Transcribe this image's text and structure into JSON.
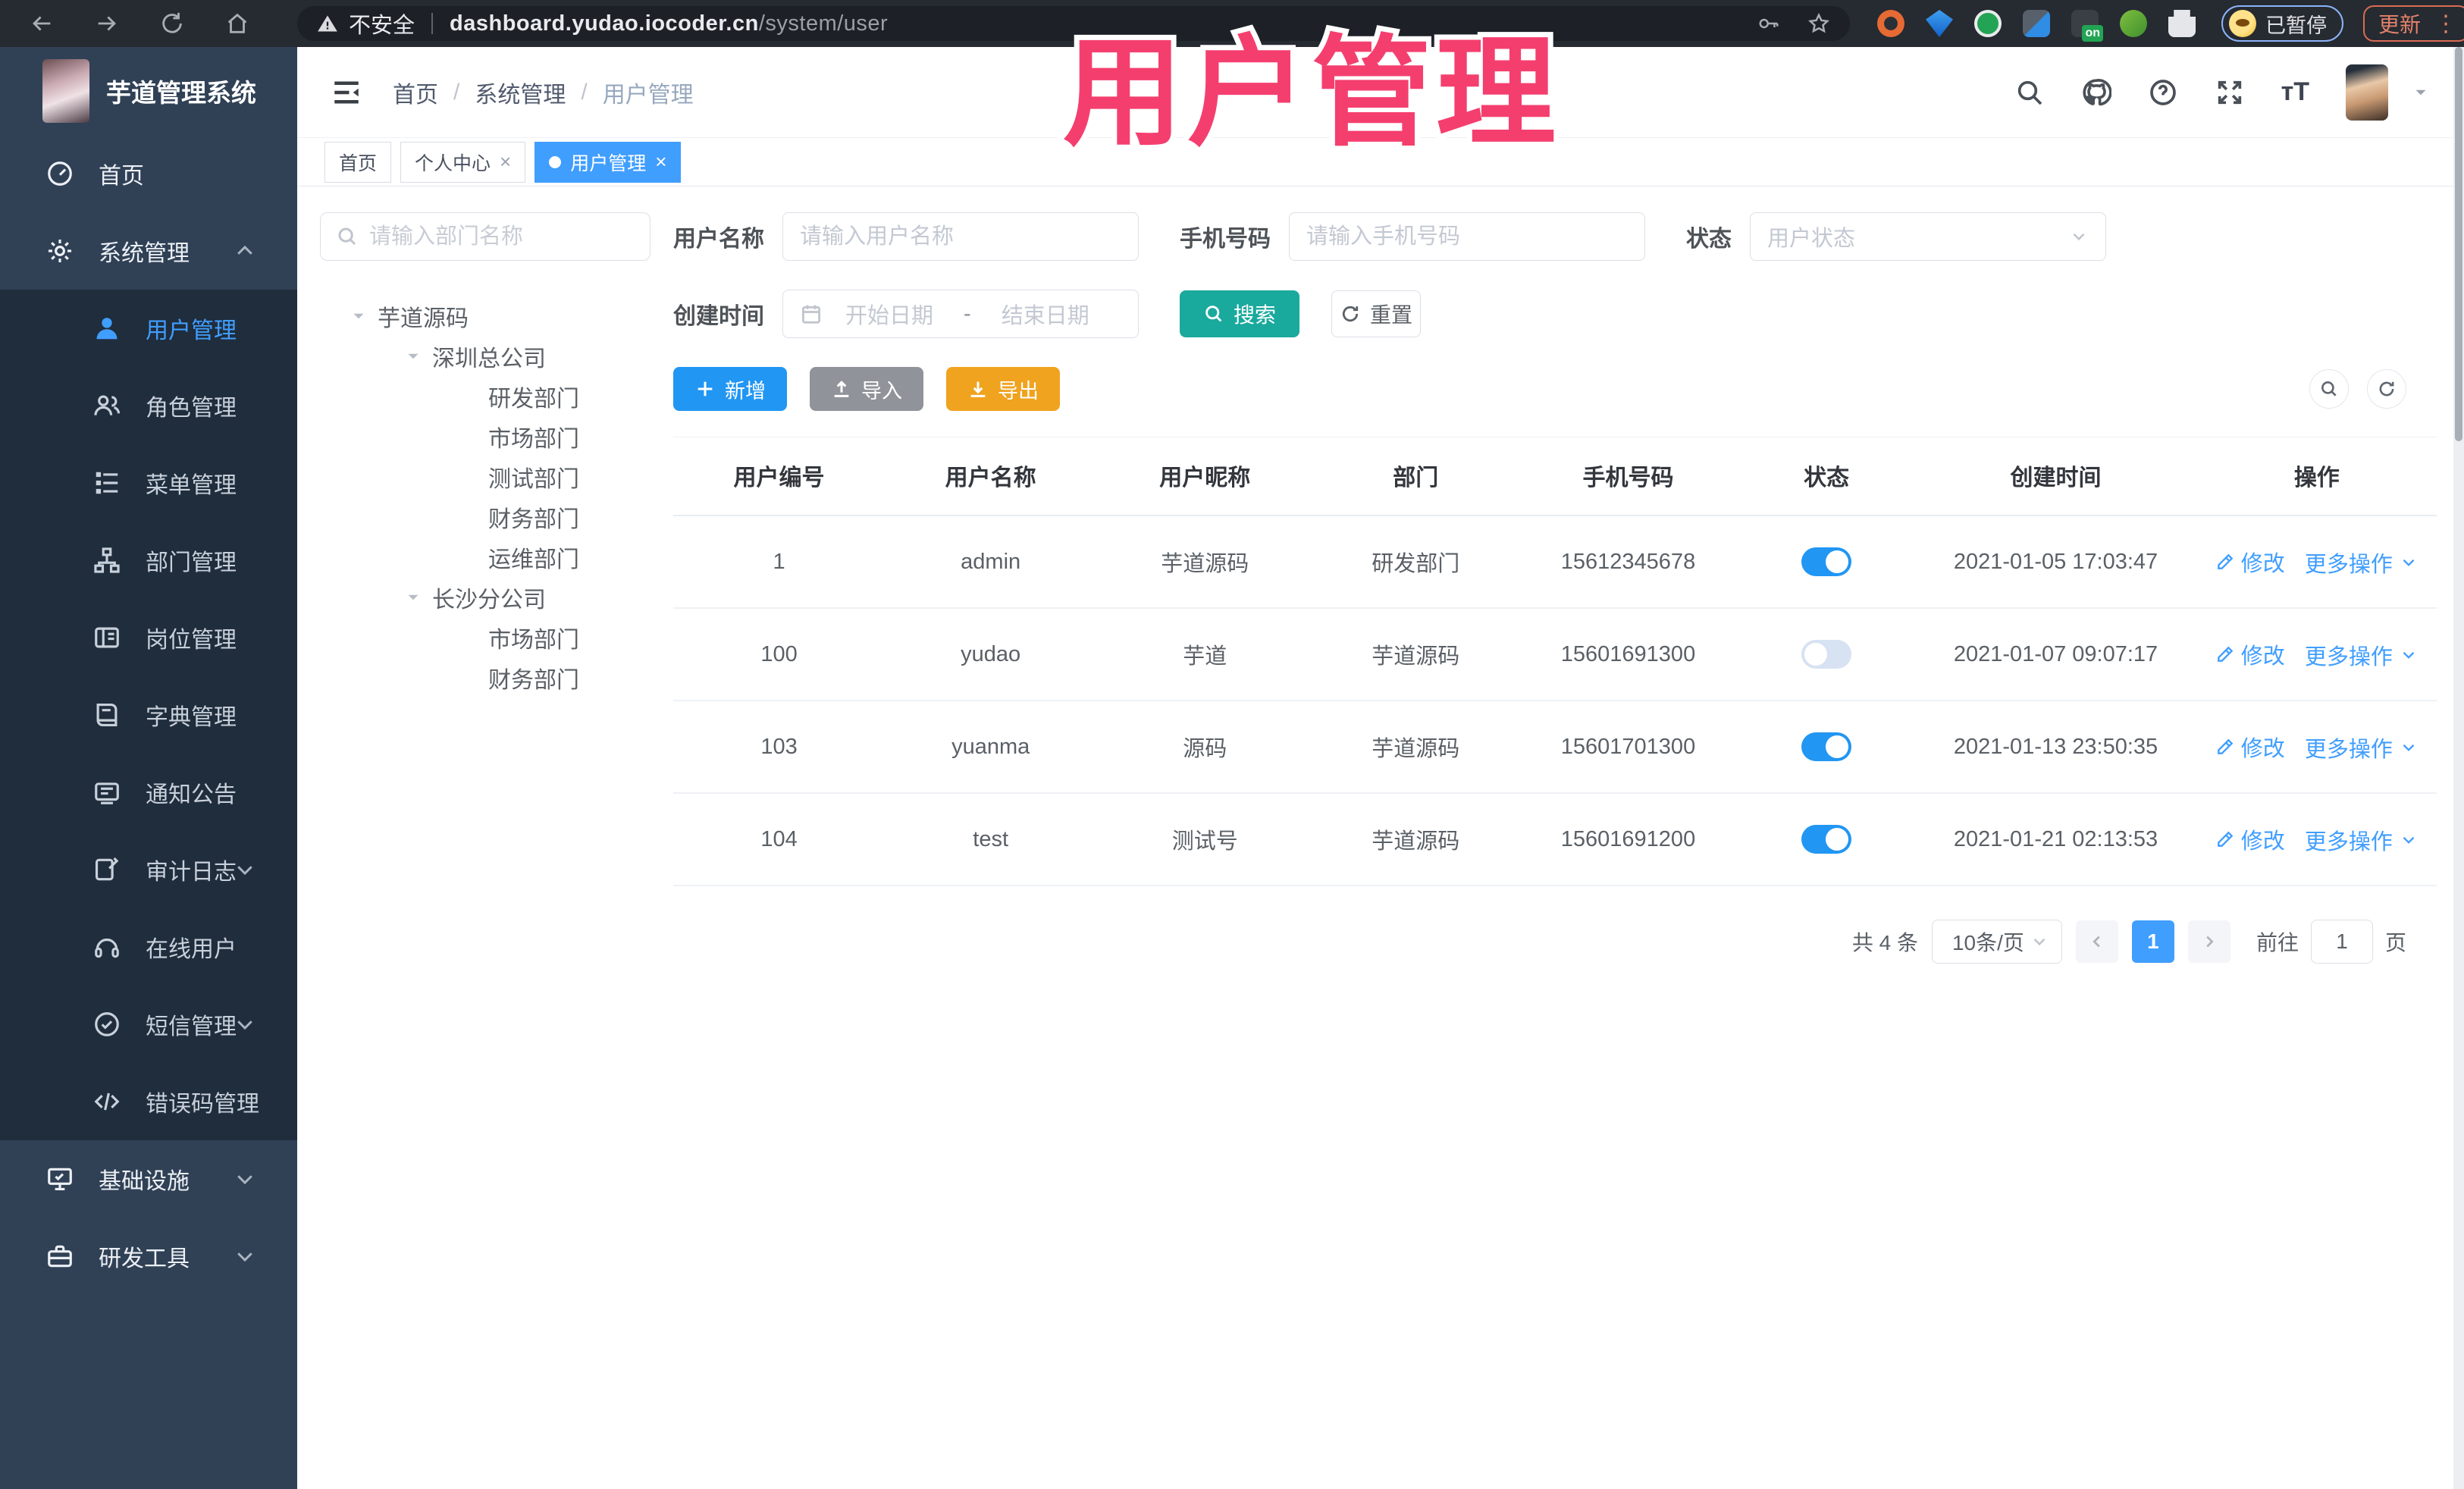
{
  "browser": {
    "security_label": "不安全",
    "url_host": "dashboard.yudao.iocoder.cn",
    "url_path": "/system/user",
    "profile_status": "已暂停",
    "update_label": "更新",
    "kebab": "⋮"
  },
  "overlay": {
    "title": "用户管理",
    "color": "#f43f6e"
  },
  "sidebar": {
    "app_title": "芋道管理系统",
    "items": [
      {
        "label": "首页",
        "icon": "dashboard-icon",
        "level": "top"
      },
      {
        "label": "系统管理",
        "icon": "gear-icon",
        "level": "top",
        "expanded": true
      },
      {
        "label": "用户管理",
        "icon": "user-icon",
        "level": "sub",
        "active": true
      },
      {
        "label": "角色管理",
        "icon": "role-icon",
        "level": "sub"
      },
      {
        "label": "菜单管理",
        "icon": "menu-list-icon",
        "level": "sub"
      },
      {
        "label": "部门管理",
        "icon": "org-tree-icon",
        "level": "sub"
      },
      {
        "label": "岗位管理",
        "icon": "post-icon",
        "level": "sub"
      },
      {
        "label": "字典管理",
        "icon": "dict-icon",
        "level": "sub"
      },
      {
        "label": "通知公告",
        "icon": "notice-icon",
        "level": "sub"
      },
      {
        "label": "审计日志",
        "icon": "audit-icon",
        "level": "sub",
        "collapsible": true
      },
      {
        "label": "在线用户",
        "icon": "online-icon",
        "level": "sub"
      },
      {
        "label": "短信管理",
        "icon": "sms-icon",
        "level": "sub",
        "collapsible": true
      },
      {
        "label": "错误码管理",
        "icon": "error-code-icon",
        "level": "sub"
      },
      {
        "label": "基础设施",
        "icon": "infra-icon",
        "level": "top",
        "collapsible": true
      },
      {
        "label": "研发工具",
        "icon": "devtool-icon",
        "level": "top",
        "collapsible": true
      }
    ]
  },
  "header": {
    "breadcrumb": [
      "首页",
      "系统管理",
      "用户管理"
    ],
    "separator": "/"
  },
  "tabs": [
    {
      "label": "首页",
      "active": false,
      "closable": false
    },
    {
      "label": "个人中心",
      "active": false,
      "closable": true
    },
    {
      "label": "用户管理",
      "active": true,
      "closable": true
    }
  ],
  "tree": {
    "search_placeholder": "请输入部门名称",
    "nodes": [
      {
        "label": "芋道源码",
        "level": 0,
        "expandable": true
      },
      {
        "label": "深圳总公司",
        "level": 1,
        "expandable": true
      },
      {
        "label": "研发部门",
        "level": 2
      },
      {
        "label": "市场部门",
        "level": 2
      },
      {
        "label": "测试部门",
        "level": 2
      },
      {
        "label": "财务部门",
        "level": 2
      },
      {
        "label": "运维部门",
        "level": 2
      },
      {
        "label": "长沙分公司",
        "level": 1,
        "expandable": true
      },
      {
        "label": "市场部门",
        "level": 2
      },
      {
        "label": "财务部门",
        "level": 2
      }
    ]
  },
  "filters": {
    "username": {
      "label": "用户名称",
      "placeholder": "请输入用户名称"
    },
    "mobile": {
      "label": "手机号码",
      "placeholder": "请输入手机号码"
    },
    "status": {
      "label": "状态",
      "placeholder": "用户状态"
    },
    "create_time": {
      "label": "创建时间",
      "start_placeholder": "开始日期",
      "separator": "-",
      "end_placeholder": "结束日期"
    },
    "search_label": "搜索",
    "reset_label": "重置"
  },
  "toolbar": {
    "add_label": "新增",
    "import_label": "导入",
    "export_label": "导出"
  },
  "table": {
    "columns": [
      "用户编号",
      "用户名称",
      "用户昵称",
      "部门",
      "手机号码",
      "状态",
      "创建时间",
      "操作"
    ],
    "actions": {
      "edit": "修改",
      "more": "更多操作"
    },
    "rows": [
      {
        "id": "1",
        "username": "admin",
        "nickname": "芋道源码",
        "dept": "研发部门",
        "mobile": "15612345678",
        "status_on": true,
        "create_time": "2021-01-05 17:03:47"
      },
      {
        "id": "100",
        "username": "yudao",
        "nickname": "芋道",
        "dept": "芋道源码",
        "mobile": "15601691300",
        "status_on": false,
        "create_time": "2021-01-07 09:07:17"
      },
      {
        "id": "103",
        "username": "yuanma",
        "nickname": "源码",
        "dept": "芋道源码",
        "mobile": "15601701300",
        "status_on": true,
        "create_time": "2021-01-13 23:50:35"
      },
      {
        "id": "104",
        "username": "test",
        "nickname": "测试号",
        "dept": "芋道源码",
        "mobile": "15601691200",
        "status_on": true,
        "create_time": "2021-01-21 02:13:53"
      }
    ]
  },
  "pagination": {
    "total_label": "共 4 条",
    "page_size_label": "10条/页",
    "current_page": "1",
    "goto_label": "前往",
    "goto_value": "1",
    "page_unit": "页"
  },
  "colors": {
    "accent": "#409eff",
    "sidebar_bg": "#304156",
    "submenu_bg": "#1f2d3d",
    "search_button": "#1aa99d",
    "add_button": "#2196f3",
    "import_button": "#909399",
    "export_button": "#f0a31f",
    "overlay_pink": "#f43f6e",
    "active_tab": "#409eff"
  }
}
